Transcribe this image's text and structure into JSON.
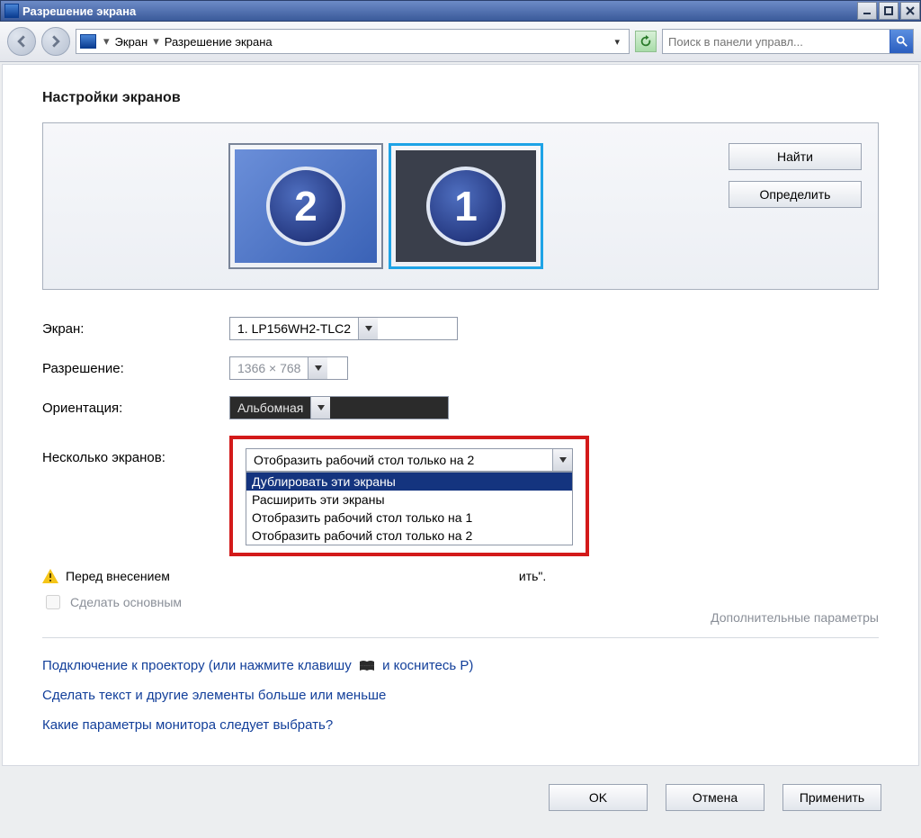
{
  "window": {
    "title": "Разрешение экрана"
  },
  "breadcrumb": {
    "item1": "Экран",
    "item2": "Разрешение экрана"
  },
  "search": {
    "placeholder": "Поиск в панели управл..."
  },
  "heading": "Настройки экранов",
  "monitors": {
    "m1": "1",
    "m2": "2"
  },
  "buttons": {
    "find": "Найти",
    "detect": "Определить"
  },
  "labels": {
    "display": "Экран:",
    "resolution": "Разрешение:",
    "orientation": "Ориентация:",
    "multiple": "Несколько экранов:"
  },
  "selects": {
    "display": "1. LP156WH2-TLC2",
    "resolution": "1366 × 768",
    "orientation": "Альбомная",
    "multiple": "Отобразить рабочий стол только на 2"
  },
  "multiple_options": {
    "opt0": "Дублировать эти экраны",
    "opt1": "Расширить эти экраны",
    "opt2": "Отобразить рабочий стол только на 1",
    "opt3": "Отобразить рабочий стол только на 2"
  },
  "warning_prefix": "Перед внесением ",
  "warning_suffix": "ить\".",
  "checkbox_label": "Сделать основным",
  "advanced": "Дополнительные параметры",
  "links": {
    "projector_pre": "Подключение к проектору (или нажмите клавишу",
    "projector_post": "и коснитесь P)",
    "textsize": "Сделать текст и другие элементы больше или меньше",
    "which": "Какие параметры монитора следует выбрать?"
  },
  "footer": {
    "ok": "OK",
    "cancel": "Отмена",
    "apply": "Применить"
  }
}
